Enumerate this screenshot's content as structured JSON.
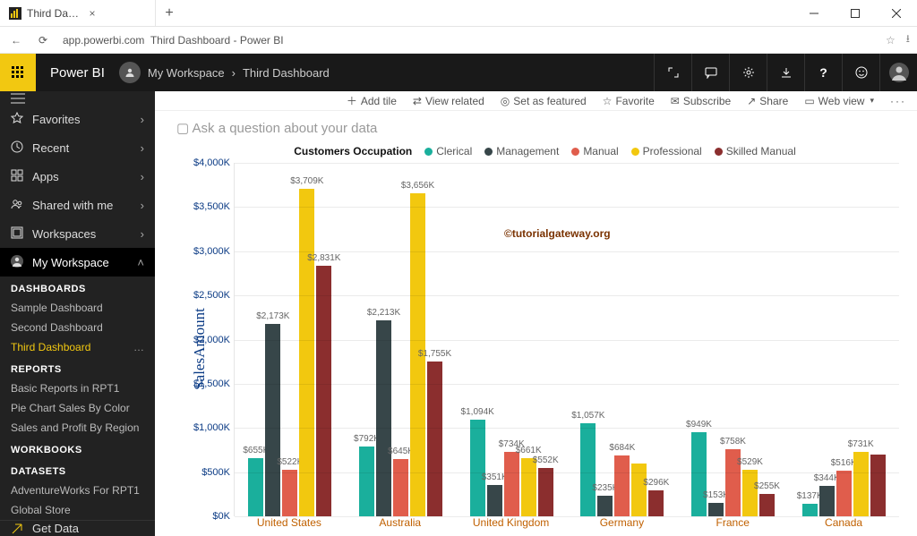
{
  "window": {
    "tab_title": "Third Dashboard - Power …",
    "address": "app.powerbi.com  Third Dashboard - Power BI"
  },
  "topbar": {
    "brand": "Power BI",
    "breadcrumb_root": "My Workspace",
    "breadcrumb_sep": "›",
    "breadcrumb_leaf": "Third Dashboard"
  },
  "sidebar": {
    "nav": [
      {
        "label": "Favorites",
        "icon": "star"
      },
      {
        "label": "Recent",
        "icon": "clock"
      },
      {
        "label": "Apps",
        "icon": "grid"
      },
      {
        "label": "Shared with me",
        "icon": "people"
      },
      {
        "label": "Workspaces",
        "icon": "workspace"
      },
      {
        "label": "My Workspace",
        "icon": "person",
        "selected": true,
        "expanded": true
      }
    ],
    "sections": {
      "dashboards_head": "DASHBOARDS",
      "dashboards": [
        "Sample Dashboard",
        "Second Dashboard",
        "Third Dashboard"
      ],
      "reports_head": "REPORTS",
      "reports": [
        "Basic Reports in RPT1",
        "Pie Chart Sales By Color",
        "Sales and Profit By Region"
      ],
      "workbooks_head": "WORKBOOKS",
      "datasets_head": "DATASETS",
      "datasets": [
        "AdventureWorks For RPT1",
        "Global Store"
      ]
    },
    "get_data": "Get Data"
  },
  "toolbar": {
    "add_tile": "Add tile",
    "view_related": "View related",
    "set_featured": "Set as featured",
    "favorite": "Favorite",
    "subscribe": "Subscribe",
    "share": "Share",
    "web_view": "Web view"
  },
  "qna_placeholder": "Ask a question about your data",
  "watermark": "©tutorialgateway.org",
  "chart_data": {
    "type": "bar",
    "legend_title": "Customers Occupation",
    "ylabel": "SalesAmount",
    "ylim": [
      0,
      4000
    ],
    "y_ticks": [
      "$0K",
      "$500K",
      "$1,000K",
      "$1,500K",
      "$2,000K",
      "$2,500K",
      "$3,000K",
      "$3,500K",
      "$4,000K"
    ],
    "series": [
      {
        "name": "Clerical",
        "color": "#1aaf9c"
      },
      {
        "name": "Management",
        "color": "#374649"
      },
      {
        "name": "Manual",
        "color": "#e05d4c"
      },
      {
        "name": "Professional",
        "color": "#f2c80f"
      },
      {
        "name": "Skilled Manual",
        "color": "#8b2e2e"
      }
    ],
    "categories": [
      "United States",
      "Australia",
      "United Kingdom",
      "Germany",
      "France",
      "Canada"
    ],
    "values": [
      {
        "Clerical": 655,
        "Management": 2173,
        "Manual": 522,
        "Professional": 3709,
        "Skilled Manual": 2831
      },
      {
        "Clerical": 792,
        "Management": 2213,
        "Manual": 645,
        "Professional": 3656,
        "Skilled Manual": 1755
      },
      {
        "Clerical": 1094,
        "Management": 351,
        "Manual": 734,
        "Professional": 661,
        "Skilled Manual": 552
      },
      {
        "Clerical": 1057,
        "Management": 235,
        "Manual": 684,
        "Professional": 600,
        "Skilled Manual": 296
      },
      {
        "Clerical": 949,
        "Management": 153,
        "Manual": 758,
        "Professional": 529,
        "Skilled Manual": 255
      },
      {
        "Clerical": 137,
        "Management": 344,
        "Manual": 516,
        "Professional": 731,
        "Skilled Manual": 700
      }
    ],
    "value_labels": [
      {
        "Clerical": "$655K",
        "Management": "$2,173K",
        "Manual": "$522K",
        "Professional": "$3,709K",
        "Skilled Manual": "$2,831K"
      },
      {
        "Clerical": "$792K",
        "Management": "$2,213K",
        "Manual": "$645K",
        "Professional": "$3,656K",
        "Skilled Manual": "$1,755K"
      },
      {
        "Clerical": "$1,094K",
        "Management": "$351K",
        "Manual": "$734K",
        "Professional": "$661K",
        "Skilled Manual": "$552K"
      },
      {
        "Clerical": "$1,057K",
        "Management": "$235K",
        "Manual": "$684K",
        "Professional": "",
        "Skilled Manual": "$296K"
      },
      {
        "Clerical": "$949K",
        "Management": "$153K",
        "Manual": "$758K",
        "Professional": "$529K",
        "Skilled Manual": "$255K"
      },
      {
        "Clerical": "$137K",
        "Management": "$344K",
        "Manual": "$516K",
        "Professional": "$731K",
        "Skilled Manual": ""
      }
    ]
  }
}
